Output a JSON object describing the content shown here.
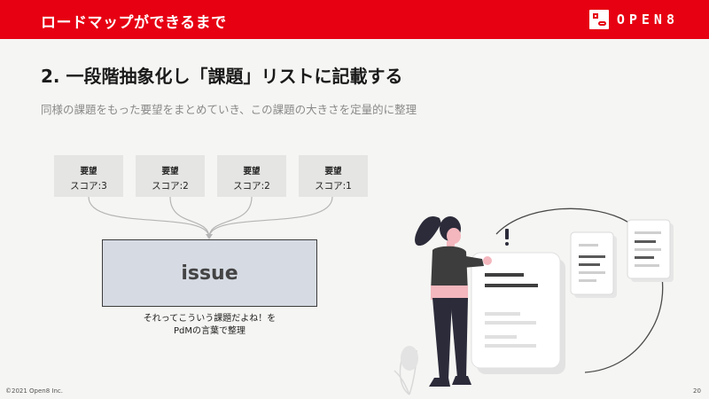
{
  "header": {
    "title": "ロードマップができるまで",
    "logo_text": "OPEN8"
  },
  "slide": {
    "heading": "2. 一段階抽象化し「課題」リストに記載する",
    "subheading": "同様の課題をもった要望をまとめていき、この課題の大きさを定量的に整理"
  },
  "cards": [
    {
      "title": "要望",
      "score": "スコア:3"
    },
    {
      "title": "要望",
      "score": "スコア:2"
    },
    {
      "title": "要望",
      "score": "スコア:2"
    },
    {
      "title": "要望",
      "score": "スコア:1"
    }
  ],
  "issue": {
    "label": "issue",
    "caption_line1": "それってこういう課題だよね！を",
    "caption_line2": "PdMの言葉で整理"
  },
  "footer": {
    "copyright": "©2021 Open8 Inc.",
    "page_number": "20"
  },
  "colors": {
    "brand_red": "#e60012",
    "card_gray": "#e5e5e3",
    "issue_fill": "#d6dbe3",
    "accent_pink": "#f3b7bd"
  }
}
